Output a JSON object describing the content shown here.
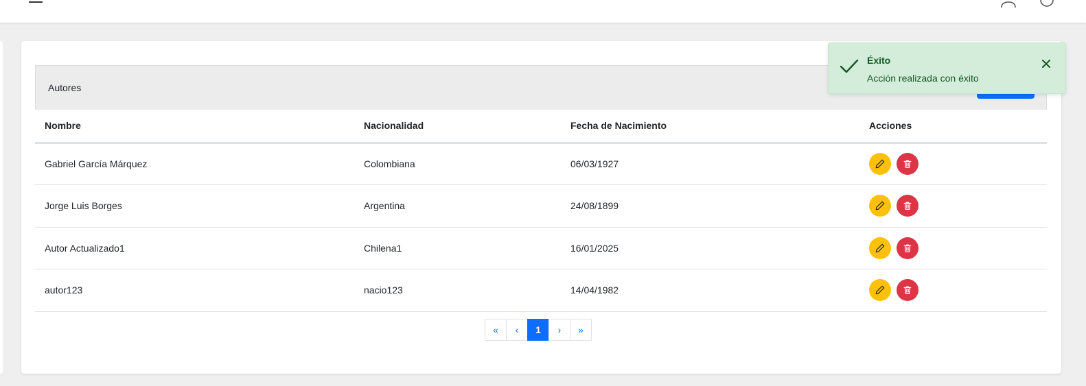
{
  "icons": {
    "menu": "menu-icon",
    "user": "user-icon",
    "power": "power-icon",
    "edit": "pencil-icon",
    "delete": "trash-icon",
    "success": "check-icon",
    "close": "close-icon"
  },
  "colors": {
    "primary": "#0d6efd",
    "edit_button": "#ffc107",
    "delete_button": "#dc3545",
    "toast_background": "#d4edda",
    "toast_text": "#155724"
  },
  "card": {
    "title": "Autores"
  },
  "table": {
    "columns": [
      "Nombre",
      "Nacionalidad",
      "Fecha de Nacimiento",
      "Acciones"
    ],
    "rows": [
      {
        "nombre": "Gabriel García Márquez",
        "nacionalidad": "Colombiana",
        "fecha": "06/03/1927"
      },
      {
        "nombre": "Jorge Luis Borges",
        "nacionalidad": "Argentina",
        "fecha": "24/08/1899"
      },
      {
        "nombre": "Autor Actualizado1",
        "nacionalidad": "Chilena1",
        "fecha": "16/01/2025"
      },
      {
        "nombre": "autor123",
        "nacionalidad": "nacio123",
        "fecha": "14/04/1982"
      }
    ]
  },
  "pagination": {
    "first": "«",
    "prev": "‹",
    "current": "1",
    "next": "›",
    "last": "»"
  },
  "toast": {
    "title": "Éxito",
    "message": "Acción realizada con éxito"
  }
}
